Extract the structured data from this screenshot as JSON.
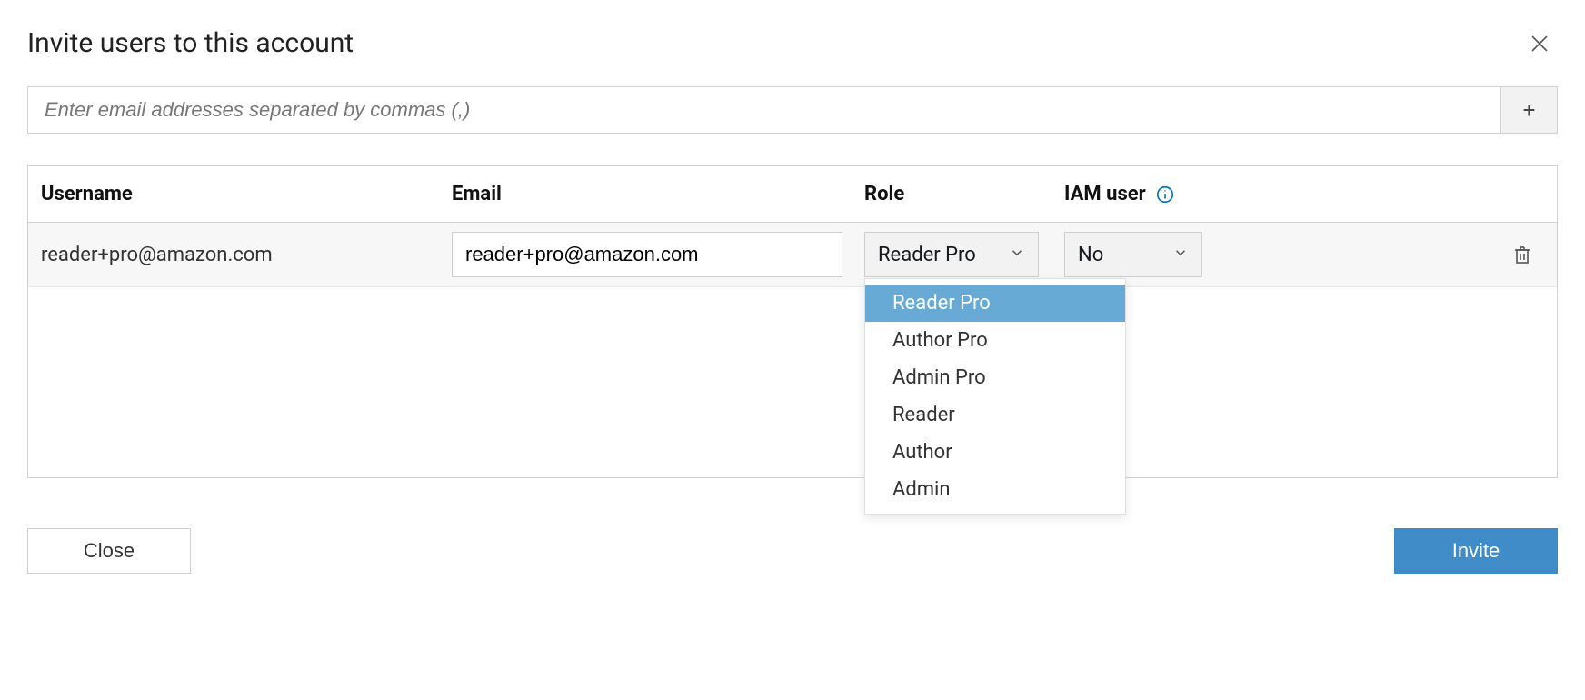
{
  "title": "Invite users to this account",
  "email_input": {
    "placeholder": "Enter email addresses separated by commas (,)",
    "value": ""
  },
  "table": {
    "headers": {
      "username": "Username",
      "email": "Email",
      "role": "Role",
      "iam": "IAM user"
    },
    "row": {
      "username": "reader+pro@amazon.com",
      "email": "reader+pro@amazon.com",
      "role_selected": "Reader Pro",
      "iam_selected": "No"
    },
    "role_options": [
      "Reader Pro",
      "Author Pro",
      "Admin Pro",
      "Reader",
      "Author",
      "Admin"
    ]
  },
  "buttons": {
    "close": "Close",
    "invite": "Invite"
  },
  "icons": {
    "add": "+"
  }
}
